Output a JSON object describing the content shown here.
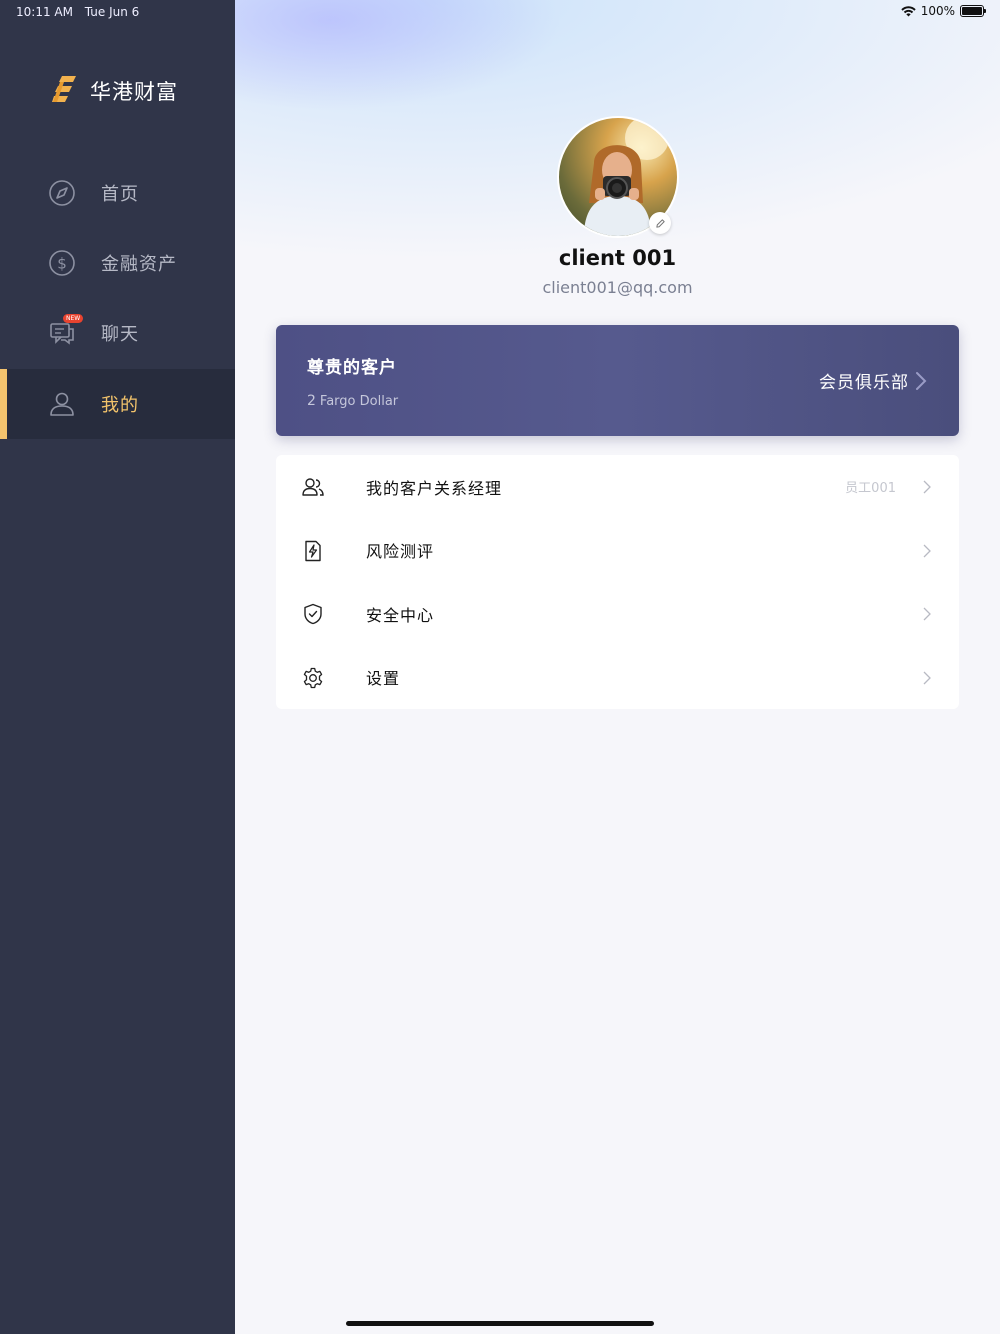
{
  "status_bar": {
    "time": "10:11 AM",
    "date": "Tue Jun 6",
    "battery": "100%"
  },
  "sidebar": {
    "brand": "华港财富",
    "items": [
      {
        "label": "首页",
        "icon": "compass-icon"
      },
      {
        "label": "金融资产",
        "icon": "dollar-circle-icon"
      },
      {
        "label": "聊天",
        "icon": "chat-icon",
        "badge": "NEW"
      },
      {
        "label": "我的",
        "icon": "user-icon",
        "active": true
      }
    ],
    "colors": {
      "background": "#303549",
      "active": "#f3c36e"
    }
  },
  "profile": {
    "name": "client 001",
    "email": "client001@qq.com"
  },
  "vip": {
    "title": "尊贵的客户",
    "points": "2",
    "points_unit": "Fargo Dollar",
    "club_label": "会员俱乐部"
  },
  "menu": [
    {
      "label": "我的客户关系经理",
      "value": "员工001",
      "icon": "users-icon"
    },
    {
      "label": "风险测评",
      "value": "",
      "icon": "lightning-doc-icon"
    },
    {
      "label": "安全中心",
      "value": "",
      "icon": "shield-check-icon"
    },
    {
      "label": "设置",
      "value": "",
      "icon": "gear-icon"
    }
  ]
}
